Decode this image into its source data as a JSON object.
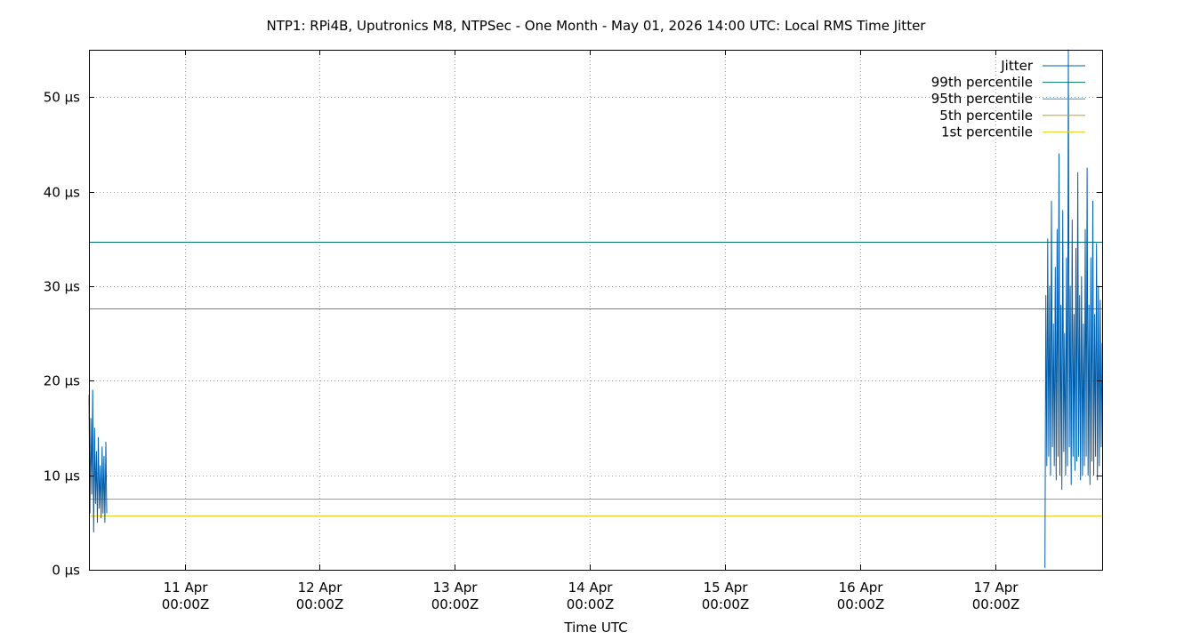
{
  "chart_data": {
    "type": "line",
    "title": "NTP1: RPi4B, Uputronics M8, NTPSec - One Month - May 01, 2026 14:00 UTC: Local RMS Time Jitter",
    "xlabel": "Time UTC",
    "ylabel": "",
    "xlim": [
      "2026-04-10T07:00Z",
      "2026-04-17T19:00Z"
    ],
    "ylim": [
      0,
      55
    ],
    "y_unit": "µs",
    "grid": true,
    "legend_position": "top-right",
    "y_ticks": [
      {
        "value": 0,
        "label": "0 µs"
      },
      {
        "value": 10,
        "label": "10 µs"
      },
      {
        "value": 20,
        "label": "20 µs"
      },
      {
        "value": 30,
        "label": "30 µs"
      },
      {
        "value": 40,
        "label": "40 µs"
      },
      {
        "value": 50,
        "label": "50 µs"
      }
    ],
    "x_ticks": [
      {
        "value": "2026-04-11T00:00Z",
        "line1": "11 Apr",
        "line2": "00:00Z"
      },
      {
        "value": "2026-04-12T00:00Z",
        "line1": "12 Apr",
        "line2": "00:00Z"
      },
      {
        "value": "2026-04-13T00:00Z",
        "line1": "13 Apr",
        "line2": "00:00Z"
      },
      {
        "value": "2026-04-14T00:00Z",
        "line1": "14 Apr",
        "line2": "00:00Z"
      },
      {
        "value": "2026-04-15T00:00Z",
        "line1": "15 Apr",
        "line2": "00:00Z"
      },
      {
        "value": "2026-04-16T00:00Z",
        "line1": "16 Apr",
        "line2": "00:00Z"
      },
      {
        "value": "2026-04-17T00:00Z",
        "line1": "17 Apr",
        "line2": "00:00Z"
      }
    ],
    "series": [
      {
        "name": "Jitter",
        "color": "#005fad",
        "segments": [
          {
            "x": [
              "2026-04-10T07:00Z",
              "2026-04-10T07:10Z",
              "2026-04-10T07:20Z",
              "2026-04-10T07:30Z",
              "2026-04-10T07:40Z",
              "2026-04-10T07:50Z",
              "2026-04-10T08:00Z",
              "2026-04-10T08:10Z",
              "2026-04-10T08:20Z",
              "2026-04-10T08:30Z",
              "2026-04-10T08:40Z",
              "2026-04-10T08:50Z",
              "2026-04-10T09:00Z",
              "2026-04-10T09:10Z",
              "2026-04-10T09:20Z",
              "2026-04-10T09:30Z",
              "2026-04-10T09:40Z",
              "2026-04-10T09:50Z",
              "2026-04-10T10:00Z",
              "2026-04-10T10:10Z"
            ],
            "y": [
              18.5,
              6.0,
              16.0,
              8.0,
              19.0,
              4.0,
              15.0,
              7.0,
              12.5,
              5.0,
              14.0,
              6.5,
              11.0,
              5.5,
              13.0,
              6.0,
              12.0,
              5.0,
              13.5,
              6.0
            ]
          },
          {
            "x": [
              "2026-04-17T08:50Z",
              "2026-04-17T09:00Z",
              "2026-04-17T09:10Z",
              "2026-04-17T09:20Z",
              "2026-04-17T09:30Z",
              "2026-04-17T09:40Z",
              "2026-04-17T09:50Z",
              "2026-04-17T10:00Z",
              "2026-04-17T10:10Z",
              "2026-04-17T10:20Z",
              "2026-04-17T10:30Z",
              "2026-04-17T10:40Z",
              "2026-04-17T10:50Z",
              "2026-04-17T11:00Z",
              "2026-04-17T11:10Z",
              "2026-04-17T11:20Z",
              "2026-04-17T11:30Z",
              "2026-04-17T11:40Z",
              "2026-04-17T11:50Z",
              "2026-04-17T12:00Z",
              "2026-04-17T12:10Z",
              "2026-04-17T12:20Z",
              "2026-04-17T12:30Z",
              "2026-04-17T12:40Z",
              "2026-04-17T12:50Z",
              "2026-04-17T13:00Z",
              "2026-04-17T13:10Z",
              "2026-04-17T13:20Z",
              "2026-04-17T13:30Z",
              "2026-04-17T13:40Z",
              "2026-04-17T13:50Z",
              "2026-04-17T14:00Z",
              "2026-04-17T14:10Z",
              "2026-04-17T14:20Z",
              "2026-04-17T14:30Z",
              "2026-04-17T14:40Z",
              "2026-04-17T14:50Z",
              "2026-04-17T15:00Z",
              "2026-04-17T15:10Z",
              "2026-04-17T15:20Z",
              "2026-04-17T15:30Z",
              "2026-04-17T15:40Z",
              "2026-04-17T15:50Z",
              "2026-04-17T16:00Z",
              "2026-04-17T16:10Z",
              "2026-04-17T16:20Z",
              "2026-04-17T16:30Z",
              "2026-04-17T16:40Z",
              "2026-04-17T16:50Z",
              "2026-04-17T17:00Z",
              "2026-04-17T17:10Z",
              "2026-04-17T17:20Z",
              "2026-04-17T17:30Z",
              "2026-04-17T17:40Z",
              "2026-04-17T17:50Z",
              "2026-04-17T18:00Z",
              "2026-04-17T18:10Z",
              "2026-04-17T18:20Z",
              "2026-04-17T18:30Z",
              "2026-04-17T18:40Z",
              "2026-04-17T18:50Z",
              "2026-04-17T19:00Z"
            ],
            "y": [
              0.2,
              29.0,
              11.0,
              35.0,
              12.0,
              30.0,
              10.0,
              39.0,
              13.0,
              26.0,
              11.0,
              32.0,
              9.5,
              36.0,
              12.0,
              44.0,
              10.0,
              28.0,
              8.5,
              38.0,
              12.5,
              25.0,
              10.0,
              33.0,
              11.0,
              55.0,
              13.0,
              30.0,
              9.0,
              37.0,
              12.0,
              27.0,
              10.5,
              34.0,
              11.5,
              42.0,
              12.0,
              29.0,
              9.5,
              31.0,
              10.0,
              26.0,
              11.0,
              36.0,
              12.0,
              42.5,
              10.0,
              28.0,
              9.0,
              33.0,
              11.5,
              39.0,
              10.0,
              27.0,
              12.0,
              34.5,
              9.5,
              30.0,
              11.0,
              28.5,
              13.0,
              24.0
            ]
          }
        ]
      },
      {
        "name": "99th percentile",
        "color": "#007070",
        "value": 34.7
      },
      {
        "name": "95th percentile",
        "color": "#1fa0c8",
        "value": 27.6
      },
      {
        "name": "5th percentile",
        "color": "#d4a000",
        "value": 7.5
      },
      {
        "name": "1st percentile",
        "color": "#e8d020",
        "value": 5.7
      }
    ]
  }
}
